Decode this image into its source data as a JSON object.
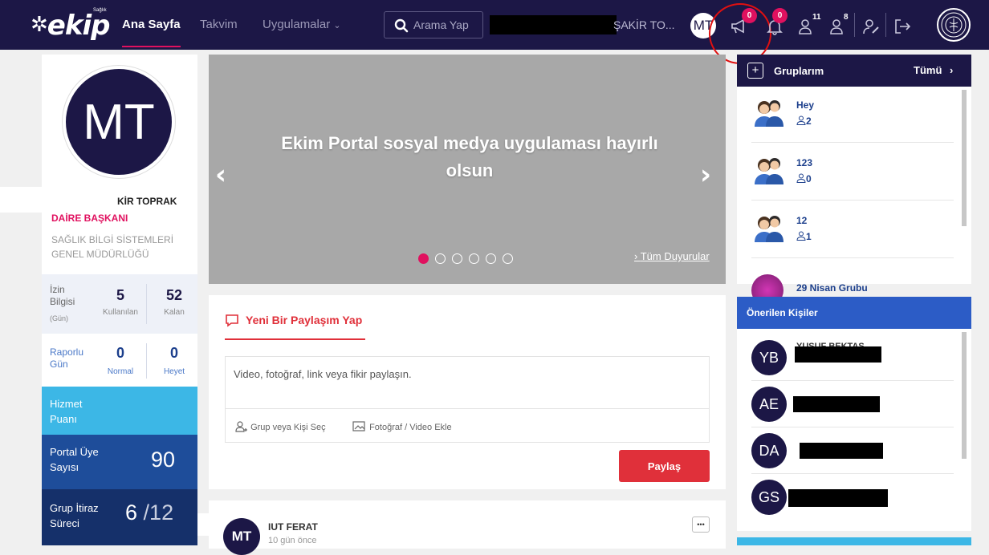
{
  "nav": {
    "logo": "ekip",
    "logo_small": "Sağlık",
    "links": [
      "Ana Sayfa",
      "Takvim",
      "Uygulamalar"
    ],
    "search_placeholder": "Arama Yap",
    "user_name": "ŞAKİR TO...",
    "user_initials": "MT",
    "announcement_badge": "0",
    "notification_badge": "0",
    "friend_request_count": "11",
    "follower_count": "8"
  },
  "profile": {
    "initials": "MT",
    "name": "KİR TOPRAK",
    "title": "DAİRE BAŞKANI",
    "department": "SAĞLIK BİLGİ SİSTEMLERİ GENEL MÜDÜRLÜĞÜ",
    "leave": {
      "label": "İzin Bilgisi",
      "unit": "(Gün)",
      "used": "5",
      "used_label": "Kullanılan",
      "remaining": "52",
      "remaining_label": "Kalan"
    },
    "report": {
      "label": "Raporlu Gün",
      "normal": "0",
      "normal_label": "Normal",
      "board": "0",
      "board_label": "Heyet"
    },
    "service_points": {
      "label": "Hizmet Puanı"
    },
    "portal_members": {
      "label": "Portal Üye Sayısı",
      "value": "90"
    },
    "group_objection": {
      "label": "Grup İtiraz Süreci",
      "value": "6",
      "total": "/12"
    }
  },
  "slider": {
    "headline": "Ekim Portal sosyal medya uygulaması hayırlı olsun",
    "all_announcements": "Tüm Duyurular",
    "slide_count": 6,
    "active_slide": 1
  },
  "post": {
    "tab": "Yeni Bir Paylaşım Yap",
    "placeholder": "Video, fotoğraf, link veya fikir paylaşın.",
    "select_target": "Grup veya Kişi Seç",
    "add_media": "Fotoğraf / Video Ekle",
    "share": "Paylaş"
  },
  "feed": {
    "author": "IUT FERAT",
    "time": "10 gün önce",
    "initials": "MT",
    "more": "•••"
  },
  "groups": {
    "title": "Gruplarım",
    "all": "Tümü",
    "items": [
      {
        "name": "Hey",
        "members": "2"
      },
      {
        "name": "123",
        "members": "0"
      },
      {
        "name": "12",
        "members": "1"
      },
      {
        "name": "29 Nisan Grubu"
      }
    ]
  },
  "people": {
    "title": "Önerilen Kişiler",
    "items": [
      {
        "initials": "YB",
        "name": "YUSUF BEKTAŞ"
      },
      {
        "initials": "AE"
      },
      {
        "initials": "DA"
      },
      {
        "initials": "GS"
      }
    ]
  },
  "colors": {
    "nav_bg": "#1c1746",
    "accent": "#e0115f",
    "primary": "#1c3f8c",
    "share_button": "#e0303a"
  }
}
